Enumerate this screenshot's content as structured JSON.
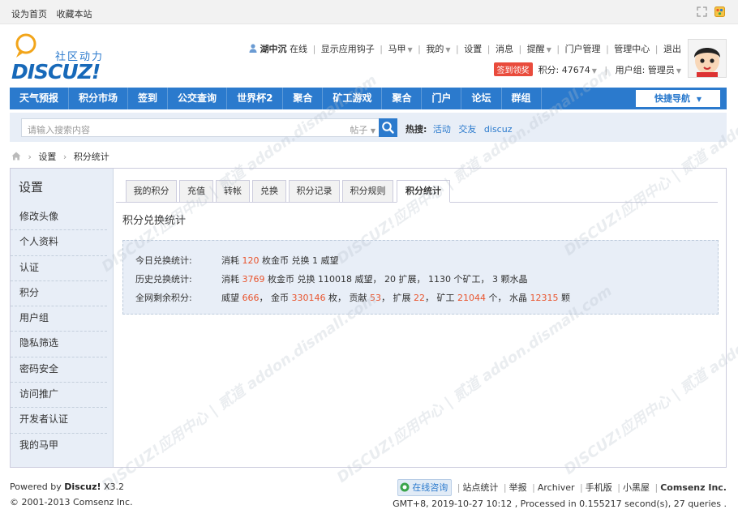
{
  "topbar": {
    "links": [
      "设为首页",
      "收藏本站"
    ]
  },
  "logo": {
    "slogan": "社区动力",
    "wordmark": "DISCUZ!"
  },
  "usernav": {
    "username": "湖中沉",
    "online": "在线",
    "items": [
      "显示应用钩子",
      "马甲",
      "我的",
      "设置",
      "消息",
      "提醒",
      "门户管理",
      "管理中心",
      "退出"
    ]
  },
  "userline2": {
    "checkin": "签到领奖",
    "credits_label": "积分: 47674",
    "group_label": "用户组: 管理员"
  },
  "mainnav": {
    "items": [
      "天气预报",
      "积分市场",
      "签到",
      "公交查询",
      "世界杯2",
      "聚合",
      "矿工游戏",
      "聚合",
      "门户",
      "论坛",
      "群组"
    ],
    "quicknav": "快捷导航"
  },
  "search": {
    "placeholder": "请输入搜索内容",
    "type": "帖子",
    "hot_label": "热搜:",
    "hot_words": [
      "活动",
      "交友",
      "discuz"
    ]
  },
  "breadcrumb": [
    "设置",
    "积分统计"
  ],
  "sidebar": {
    "title": "设置",
    "items": [
      "修改头像",
      "个人资料",
      "认证",
      "积分",
      "用户组",
      "隐私筛选",
      "密码安全",
      "访问推广",
      "开发者认证",
      "我的马甲"
    ]
  },
  "tabs": [
    "我的积分",
    "充值",
    "转帐",
    "兑换",
    "积分记录",
    "积分规则",
    "积分统计"
  ],
  "section_title": "积分兑换统计",
  "stats": {
    "today": {
      "label": "今日兑换统计:",
      "t1": "消耗 ",
      "n1": "120",
      "t2": " 枚金币 兑换 1 威望"
    },
    "history": {
      "label": "历史兑换统计:",
      "t1": "消耗 ",
      "n1": "3769",
      "t2": " 枚金币 兑换 110018 威望， 20 扩展， 1130 个矿工， 3 颗水晶"
    },
    "total": {
      "label": "全网剩余积分:",
      "t1": "威望 ",
      "n1": "666",
      "t2": "， 金币 ",
      "n2": "330146",
      "t3": " 枚， 贡献 ",
      "n3": "53",
      "t4": "， 扩展 ",
      "n4": "22",
      "t5": "， 矿工 ",
      "n5": "21044",
      "t6": " 个， 水晶 ",
      "n6": "12315",
      "t7": " 颗"
    }
  },
  "footer": {
    "powered_prefix": "Powered by ",
    "powered_brand": "Discuz!",
    "powered_version": " X3.2",
    "copyright": "© 2001-2013 Comsenz Inc.",
    "consult": "在线咨询",
    "links": [
      "站点统计",
      "举报",
      "Archiver",
      "手机版",
      "小黑屋"
    ],
    "brand": "Comsenz Inc.",
    "timing": "GMT+8, 2019-10-27 10:12 , Processed in 0.155217 second(s), 27 queries ."
  },
  "colors": {
    "nav_blue": "#2b7acd",
    "highlight": "#e9542d",
    "panel_bg": "#e8eef7"
  },
  "watermark": "DISCUZ!应用中心 | 贰道 addon.dismall.com"
}
